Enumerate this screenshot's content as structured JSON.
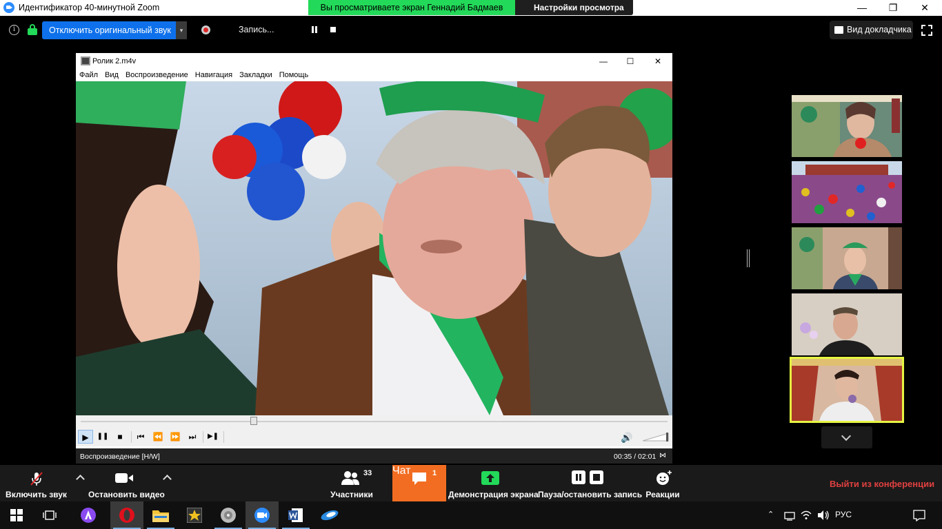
{
  "window": {
    "title": "Идентификатор 40-минутной Zoom",
    "minimize": "—",
    "maximize": "❐",
    "close": "✕"
  },
  "share_banner": {
    "viewing_text": "Вы просматриваете экран Геннадий Бадмаев",
    "view_options": "Настройки просмотра ⌄"
  },
  "top_toolbar": {
    "original_sound_button": "Отключить оригинальный звук",
    "dropdown_arrow": "▾",
    "recording_label": "Запись...",
    "speaker_view": "Вид докладчика"
  },
  "player": {
    "title": "Ролик 2.m4v",
    "minimize": "—",
    "maximize": "☐",
    "close": "✕",
    "menu": [
      "Файл",
      "Вид",
      "Воспроизведение",
      "Навигация",
      "Закладки",
      "Помощь"
    ],
    "controls": {
      "play": "▶",
      "pause": "❚❚",
      "stop": "■",
      "prev": "⏮",
      "rewind": "⏪",
      "forward": "⏩",
      "next": "⏭",
      "frame_step": "▶❚",
      "volume": "🔊"
    },
    "seek_position": 0.295,
    "status_left": "Воспроизведение [H/W]",
    "time": "00:35 / 02:01",
    "status_icon": "⋈"
  },
  "bottom_toolbar": {
    "unmute": "Включить звук",
    "stop_video": "Остановить видео",
    "participants": "Участники",
    "participants_count": "33",
    "chat": "Чат",
    "chat_badge": "1",
    "share_screen": "Демонстрация экрана",
    "pause_stop_record": "Пауза/остановить запись",
    "reactions": "Реакции",
    "leave": "Выйти из конференции"
  },
  "taskbar": {
    "language": "РУС"
  },
  "colors": {
    "zoom_blue": "#0e71eb",
    "share_green": "#23d959",
    "chat_orange": "#f26d21",
    "leave_red": "#e04040",
    "active_speaker": "#e6f542"
  }
}
